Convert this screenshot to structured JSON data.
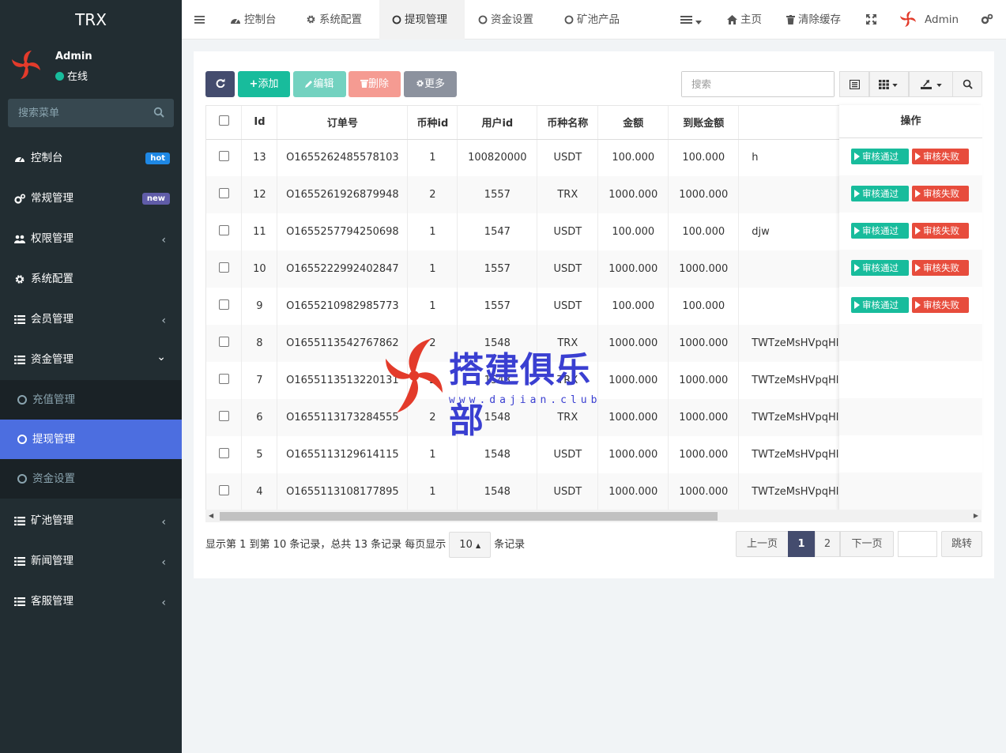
{
  "brand": "TRX",
  "user": {
    "name": "Admin",
    "status": "在线"
  },
  "sidebar_search": {
    "placeholder": "搜索菜单"
  },
  "menu": [
    {
      "label": "控制台",
      "icon": "dashboard-icon",
      "badge": "hot"
    },
    {
      "label": "常规管理",
      "icon": "cogs-icon",
      "badge": "new"
    },
    {
      "label": "权限管理",
      "icon": "users-icon",
      "chevron": "‹"
    },
    {
      "label": "系统配置",
      "icon": "gear-icon"
    },
    {
      "label": "会员管理",
      "icon": "list-icon",
      "chevron": "‹"
    },
    {
      "label": "资金管理",
      "icon": "list-icon",
      "chevron": "⌄"
    }
  ],
  "submenu": [
    {
      "label": "充值管理"
    },
    {
      "label": "提现管理"
    },
    {
      "label": "资金设置"
    }
  ],
  "menu_after": [
    {
      "label": "矿池管理",
      "icon": "list-icon",
      "chevron": "‹"
    },
    {
      "label": "新闻管理",
      "icon": "list-icon",
      "chevron": "‹"
    },
    {
      "label": "客服管理",
      "icon": "list-icon",
      "chevron": "‹"
    }
  ],
  "topnav": {
    "tabs": [
      "控制台",
      "系统配置",
      "提现管理",
      "资金设置",
      "矿池产品"
    ],
    "home": "主页",
    "clear_cache": "清除缓存",
    "admin": "Admin"
  },
  "toolbar": {
    "add": "添加",
    "edit": "编辑",
    "delete": "删除",
    "more": "更多",
    "search_placeholder": "搜索"
  },
  "colors": {
    "sidebar": "#222d32",
    "active_menu": "#4c6ee0",
    "btn_refresh": "#444c6e",
    "btn_add": "#18bc9c",
    "btn_edit": "#73d2c0",
    "btn_delete": "#f59b92",
    "btn_more": "#8c929e",
    "approve": "#18bc9c",
    "reject": "#e74c3c"
  },
  "table": {
    "headers": [
      "Id",
      "订单号",
      "币种id",
      "用户id",
      "币种名称",
      "金额",
      "到账金额",
      "",
      "操作"
    ],
    "rows": [
      [
        "13",
        "O1655262485578103",
        "1",
        "100820000",
        "USDT",
        "100.000",
        "100.000",
        "h"
      ],
      [
        "12",
        "O1655261926879948",
        "2",
        "1557",
        "TRX",
        "1000.000",
        "1000.000",
        ""
      ],
      [
        "11",
        "O1655257794250698",
        "1",
        "1547",
        "USDT",
        "100.000",
        "100.000",
        "djw"
      ],
      [
        "10",
        "O1655222992402847",
        "1",
        "1557",
        "USDT",
        "1000.000",
        "1000.000",
        ""
      ],
      [
        "9",
        "O1655210982985773",
        "1",
        "1557",
        "USDT",
        "100.000",
        "100.000",
        ""
      ],
      [
        "8",
        "O1655113542767862",
        "2",
        "1548",
        "TRX",
        "1000.000",
        "1000.000",
        "TWTzeMsHVpqHl"
      ],
      [
        "7",
        "O1655113513220131",
        "2",
        "1548",
        "TRX",
        "1000.000",
        "1000.000",
        "TWTzeMsHVpqHl"
      ],
      [
        "6",
        "O1655113173284555",
        "2",
        "1548",
        "TRX",
        "1000.000",
        "1000.000",
        "TWTzeMsHVpqHl"
      ],
      [
        "5",
        "O1655113129614115",
        "1",
        "1548",
        "USDT",
        "1000.000",
        "1000.000",
        "TWTzeMsHVpqHl"
      ],
      [
        "4",
        "O1655113108177895",
        "1",
        "1548",
        "USDT",
        "1000.000",
        "1000.000",
        "TWTzeMsHVpqHl"
      ]
    ],
    "actions_rows": 5,
    "approve_label": "审核通过",
    "reject_label": "审核失败"
  },
  "pagination": {
    "info_prefix": "显示第 1 到第 10 条记录，总共 13 条记录 每页显示",
    "page_size": "10",
    "info_suffix": "条记录",
    "prev": "上一页",
    "pages": [
      "1",
      "2"
    ],
    "next": "下一页",
    "jump": "跳转"
  },
  "watermark": {
    "text": "搭建俱乐部",
    "url": "www.dajian.club"
  }
}
